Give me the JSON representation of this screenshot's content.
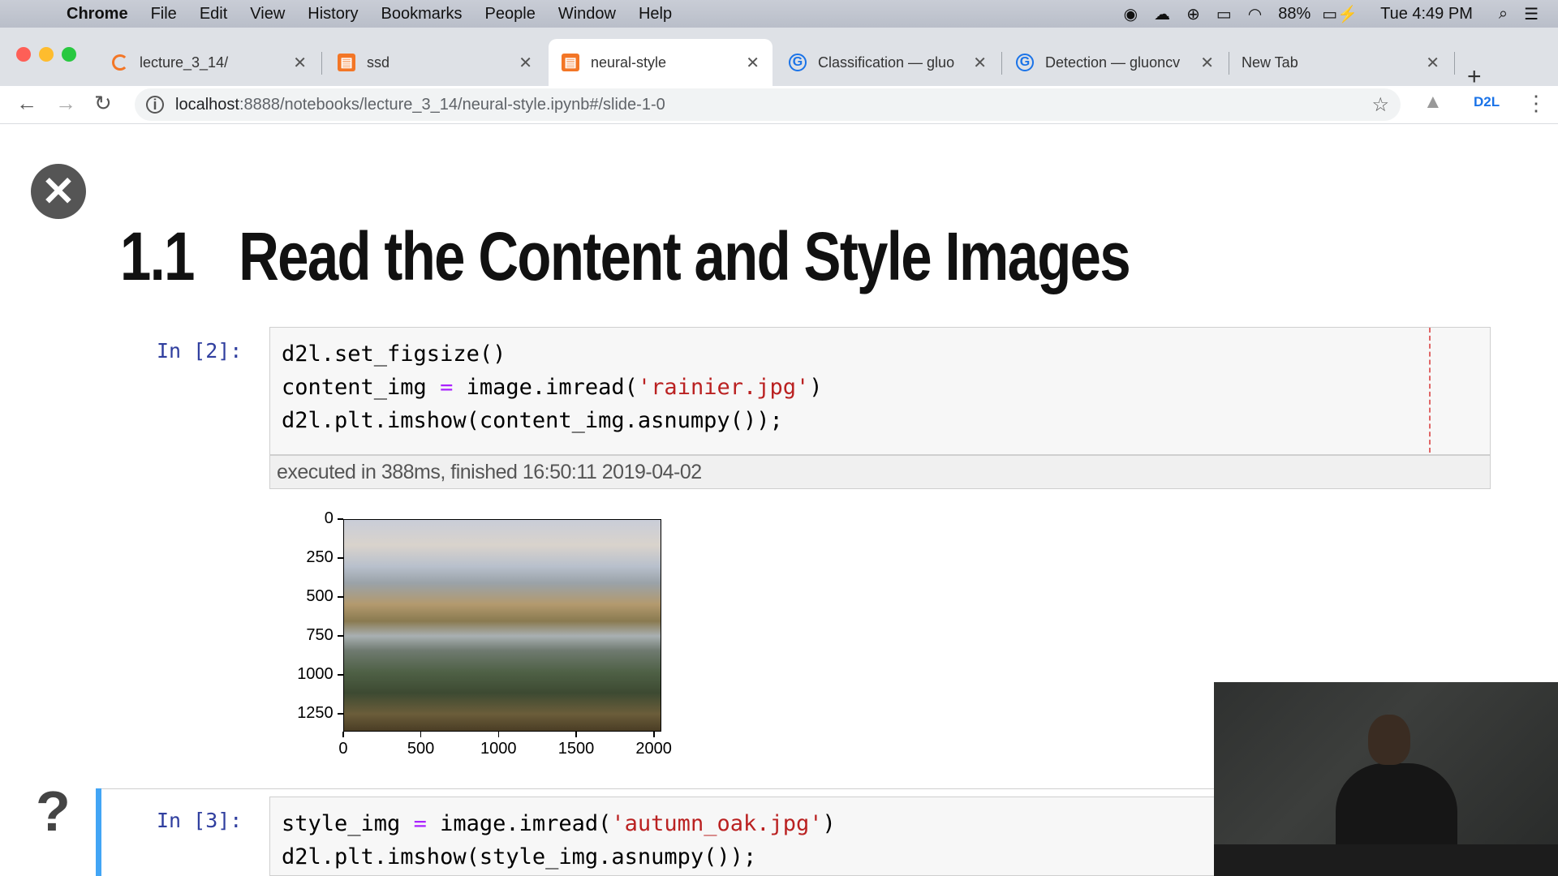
{
  "menubar": {
    "app": "Chrome",
    "items": [
      "File",
      "Edit",
      "View",
      "History",
      "Bookmarks",
      "People",
      "Window",
      "Help"
    ],
    "battery": "88%",
    "clock": "Tue 4:49 PM"
  },
  "tabs": [
    {
      "label": "lecture_3_14/",
      "icon": "loading-icon"
    },
    {
      "label": "ssd",
      "icon": "notebook-icon"
    },
    {
      "label": "neural-style",
      "icon": "notebook-icon",
      "active": true
    },
    {
      "label": "Classification — gluo",
      "icon": "gluon-icon"
    },
    {
      "label": "Detection — gluoncv",
      "icon": "gluon-icon"
    },
    {
      "label": "New Tab",
      "icon": ""
    }
  ],
  "address": {
    "host": "localhost",
    "path": ":8888/notebooks/lecture_3_14/neural-style.ipynb#/slide-1-0"
  },
  "extension_label": "D2L",
  "slide": {
    "heading_number": "1.1",
    "heading_text": "Read the Content and Style Images"
  },
  "cells": [
    {
      "prompt": "In [2]:",
      "lines": [
        [
          "d2l.set_figsize()"
        ],
        [
          "content_img ",
          "=",
          " image.imread(",
          "'rainier.jpg'",
          ")"
        ],
        [
          "d2l.plt.imshow(content_img.asnumpy());"
        ]
      ],
      "timing": "executed in 388ms, finished 16:50:11 2019-04-02"
    },
    {
      "prompt": "In [3]:",
      "lines": [
        [
          "style_img ",
          "=",
          " image.imread(",
          "'autumn_oak.jpg'",
          ")"
        ],
        [
          "d2l.plt.imshow(style_img.asnumpy());"
        ]
      ]
    }
  ],
  "chart_data": {
    "type": "image",
    "x_ticks": [
      "0",
      "500",
      "1000",
      "1500",
      "2000"
    ],
    "y_ticks": [
      "0",
      "250",
      "500",
      "750",
      "1000",
      "1250"
    ],
    "xlim": [
      0,
      2048
    ],
    "ylim": [
      1365,
      0
    ]
  },
  "colors": {
    "prompt": "#303f9f",
    "string": "#ba2121",
    "operator": "#aa22ff",
    "active_cell": "#42a5f5"
  }
}
